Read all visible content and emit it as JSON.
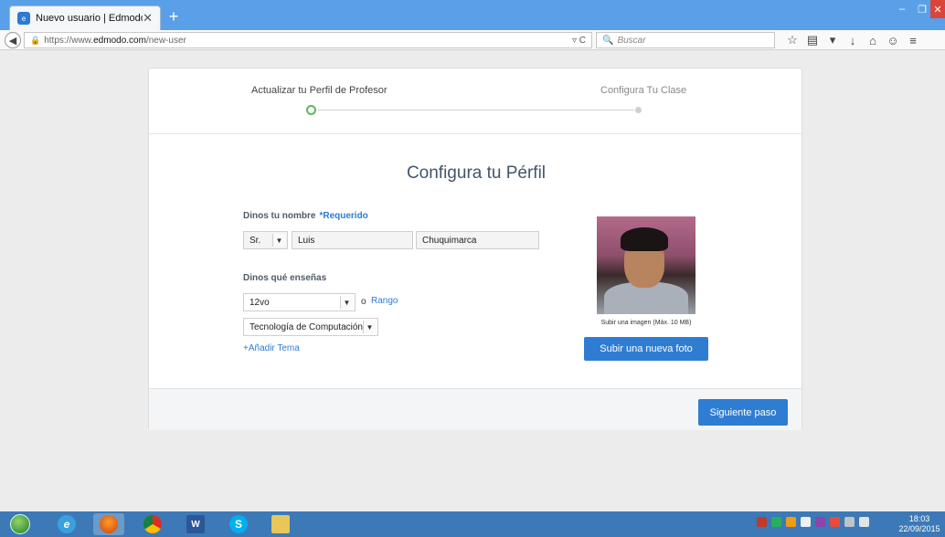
{
  "browser": {
    "tab_title": "Nuevo usuario | Edmodo",
    "tab_close": "✕",
    "new_tab": "+",
    "url_prefix": "https://www.",
    "url_host": "edmodo.com",
    "url_path": "/new-user",
    "search_placeholder": "Buscar",
    "window_min": "–",
    "window_max": "❐",
    "window_close": "✕"
  },
  "steps": {
    "step1": "Actualizar tu Perfil de Profesor",
    "step2": "Configura Tu Clase",
    "active_color": "#5cb85c"
  },
  "form": {
    "heading": "Configura tu Pérfil",
    "name_label": "Dinos tu nombre",
    "required": "*Requerido",
    "title_value": "Sr.",
    "first_name": "Luis",
    "last_name": "Chuquimarca",
    "teach_label": "Dinos qué enseñas",
    "grade_value": "12vo",
    "or_text": "o",
    "range_link": "Rango",
    "subject_value": "Tecnología de Computación",
    "add_subject": "+Añadir Tema"
  },
  "photo": {
    "caption": "Subir una imagen (Máx. 10 MB)",
    "upload_button": "Subir una nueva foto"
  },
  "footer": {
    "next_button": "Siguiente paso"
  },
  "taskbar": {
    "time": "18:03",
    "date": "22/09/2015"
  },
  "colors": {
    "accent": "#2f7dd3",
    "link": "#2c7bd6",
    "taskbar": "#3c79b6"
  }
}
